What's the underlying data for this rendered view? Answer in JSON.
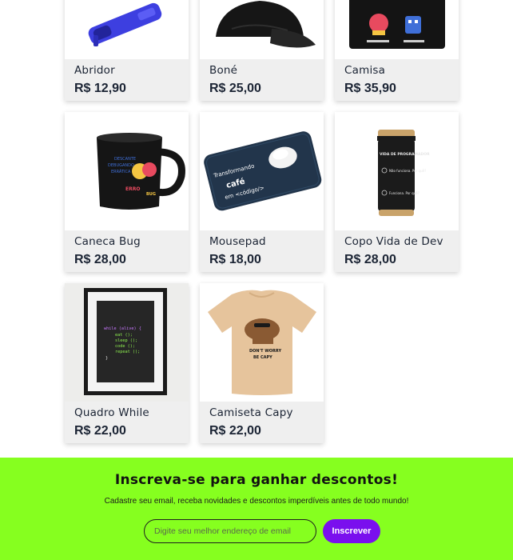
{
  "products": [
    {
      "name": "Abridor",
      "price": "R$ 12,90",
      "image": "bottle-opener-image"
    },
    {
      "name": "Boné",
      "price": "R$ 25,00",
      "image": "cap-image"
    },
    {
      "name": "Camisa",
      "price": "R$ 35,90",
      "image": "shirt-image"
    },
    {
      "name": "Caneca Bug",
      "price": "R$ 28,00",
      "image": "mug-image"
    },
    {
      "name": "Mousepad",
      "price": "R$ 18,00",
      "image": "mousepad-image"
    },
    {
      "name": "Copo Vida de Dev",
      "price": "R$ 28,00",
      "image": "tumbler-image"
    },
    {
      "name": "Quadro While",
      "price": "R$ 22,00",
      "image": "poster-image"
    },
    {
      "name": "Camiseta Capy",
      "price": "R$ 22,00",
      "image": "tshirt-image"
    }
  ],
  "product_art": {
    "mousepad_text": [
      "Transformando",
      "café",
      "em <código/>"
    ],
    "mug_text": [
      "DESCANTE",
      "DEBUGANDO",
      "ERRÁTICA",
      "ERRO",
      "BUG"
    ],
    "tumbler_text": [
      "VIDA DE PROGRAMADOR",
      "Não funciona. Por quê?",
      "Funciona. Por quê?"
    ],
    "poster_code": [
      "while (alive) {",
      "eat ();",
      "sleep ();",
      "code ();",
      "repeat ();",
      "}"
    ],
    "tshirt_text": [
      "DON'T WORRY",
      "BE CAPY"
    ]
  },
  "newsletter": {
    "title": "Inscreva-se para ganhar descontos!",
    "subtitle": "Cadastre seu email, receba novidades e descontos imperdíveis antes de todo mundo!",
    "placeholder": "Digite seu melhor endereço de email",
    "button": "Inscrever"
  },
  "colors": {
    "accent_green": "#86ff1f",
    "accent_purple": "#7a0fee",
    "text_dark": "#1b2434",
    "card_bg": "#efefef"
  }
}
